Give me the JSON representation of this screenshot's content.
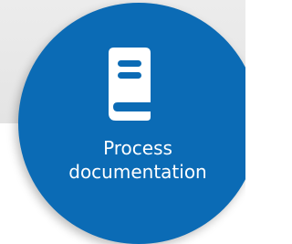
{
  "tile": {
    "title_line1": "Process",
    "title_line2": "documentation",
    "icon": "book-icon",
    "accent_color": "#0b6bb5",
    "text_color": "#ffffff",
    "backdrop_color": "#e8e8e8"
  }
}
